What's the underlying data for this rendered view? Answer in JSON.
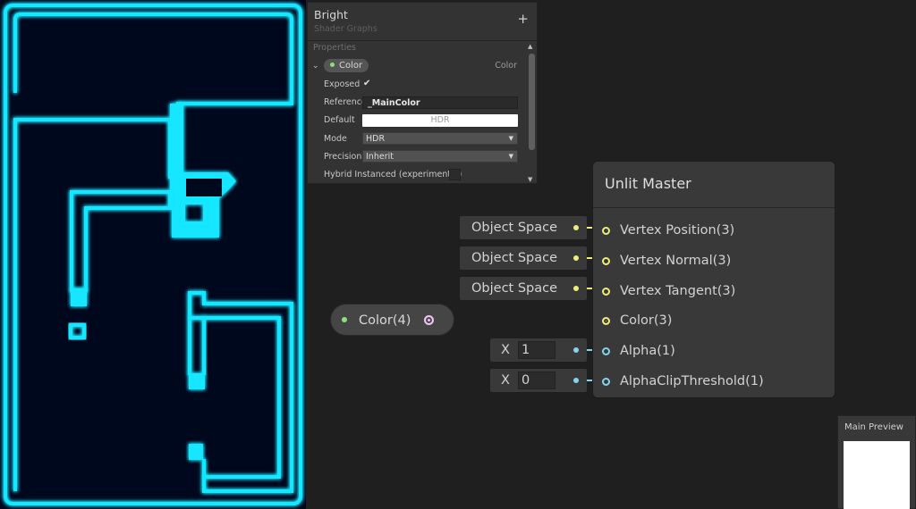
{
  "blackboard": {
    "title": "Bright",
    "subtitle": "Shader Graphs",
    "add_icon": "+",
    "section_label": "Properties",
    "property": {
      "name": "Color",
      "type": "Color",
      "exposed_label": "Exposed",
      "exposed_checked": true,
      "check_glyph": "✔",
      "reference_label": "Reference",
      "reference_value": "_MainColor",
      "default_label": "Default",
      "default_value": "HDR",
      "mode_label": "Mode",
      "mode_value": "HDR",
      "precision_label": "Precision",
      "precision_value": "Inherit",
      "hybrid_label": "Hybrid Instanced (experimental)",
      "hybrid_checked": false
    }
  },
  "master_node": {
    "title": "Unlit Master",
    "ports": [
      "Vertex Position(3)",
      "Vertex Normal(3)",
      "Vertex Tangent(3)",
      "Color(3)",
      "Alpha(1)",
      "AlphaClipThreshold(1)"
    ]
  },
  "inputs": {
    "space_1": "Object Space",
    "space_2": "Object Space",
    "space_3": "Object Space",
    "alpha_axis": "X",
    "alpha_value": "1",
    "clip_axis": "X",
    "clip_value": "0"
  },
  "color_node": {
    "label": "Color(4)"
  },
  "preview": {
    "title": "Main Preview"
  },
  "colors": {
    "neon": "#18e6ff",
    "game_bg": "#00081e",
    "port_yellow": "#eded7a",
    "port_cyan": "#84d4f0",
    "port_pink": "#eec4f0"
  }
}
